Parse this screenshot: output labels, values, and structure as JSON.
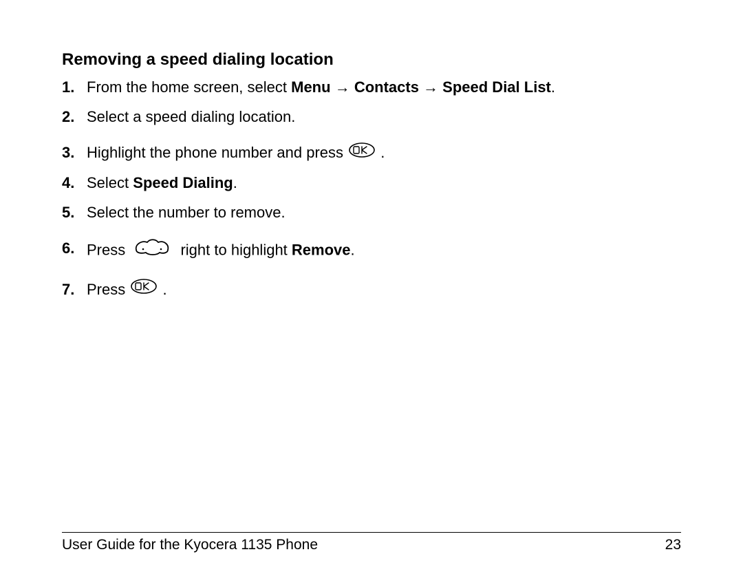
{
  "heading": "Removing a speed dialing location",
  "steps": [
    {
      "num": "1.",
      "pre": "From the home screen, select ",
      "bold1": "Menu",
      "arrow1": " → ",
      "bold2": "Contacts",
      "arrow2": " → ",
      "bold3": "Speed Dial List",
      "post": "."
    },
    {
      "num": "2.",
      "text": "Select a speed dialing location."
    },
    {
      "num": "3.",
      "pre": "Highlight the phone number and press ",
      "icon": "ok",
      "post": " ."
    },
    {
      "num": "4.",
      "pre": "Select ",
      "bold1": "Speed Dialing",
      "post": "."
    },
    {
      "num": "5.",
      "text": "Select the number to remove."
    },
    {
      "num": "6.",
      "pre": "Press ",
      "icon": "nav",
      "mid": " right to highlight ",
      "bold1": "Remove",
      "post": "."
    },
    {
      "num": "7.",
      "pre": "Press ",
      "icon": "ok",
      "post": " ."
    }
  ],
  "footer": {
    "title": "User Guide for the Kyocera 1135 Phone",
    "page": "23"
  }
}
